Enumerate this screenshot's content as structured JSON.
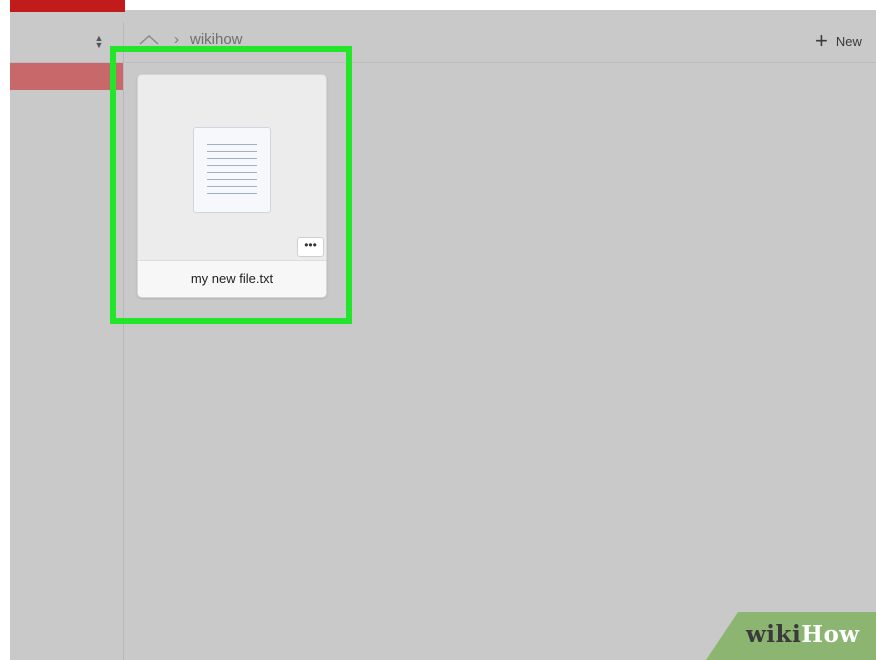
{
  "header": {
    "breadcrumb": {
      "folder_label": "wikihow"
    },
    "new_button_label": "New"
  },
  "file_grid": {
    "files": [
      {
        "name": "my new file.txt",
        "menu_label": "•••",
        "icon": "text-document-icon"
      }
    ]
  },
  "watermark": {
    "wiki": "wiki",
    "how": "How"
  },
  "colors": {
    "accent_red": "#c11b1b",
    "sidebar_selected": "#c9686b",
    "highlight_green": "#22e52c",
    "watermark_green": "#8cb572"
  }
}
